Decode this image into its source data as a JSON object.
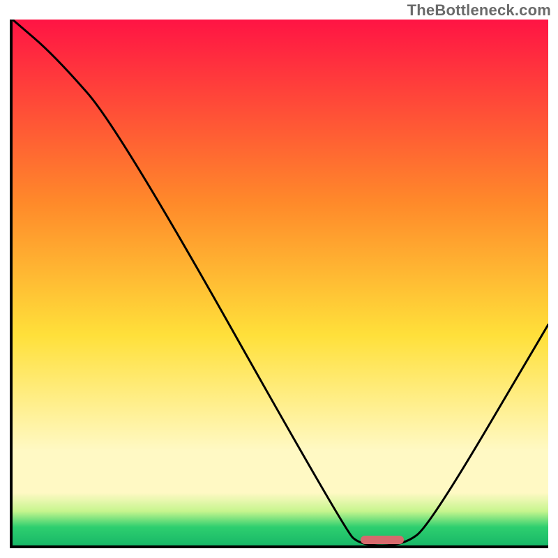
{
  "watermark": "TheBottleneck.com",
  "colors": {
    "top": "#ff1444",
    "mid_top": "#ff8a2a",
    "mid": "#ffe03a",
    "cream": "#fff9c4",
    "band_light": "#c6f58e",
    "band_green": "#2ecf6f",
    "band_dark": "#18b868",
    "curve": "#000000",
    "marker": "#d66a6d",
    "axis": "#000000"
  },
  "chart_data": {
    "type": "line",
    "title": "",
    "xlabel": "",
    "ylabel": "",
    "xlim": [
      0,
      100
    ],
    "ylim": [
      0,
      100
    ],
    "x": [
      0,
      8,
      20,
      62,
      65,
      73,
      78,
      100
    ],
    "values": [
      100,
      93,
      79,
      3,
      0,
      0,
      4,
      42
    ],
    "annotations": [
      {
        "kind": "marker",
        "x_start": 65,
        "x_end": 73,
        "y": 0
      }
    ],
    "gradient_stops": [
      {
        "offset": 0.0,
        "color_key": "top"
      },
      {
        "offset": 0.35,
        "color_key": "mid_top"
      },
      {
        "offset": 0.6,
        "color_key": "mid"
      },
      {
        "offset": 0.82,
        "color_key": "cream"
      },
      {
        "offset": 0.9,
        "color_key": "cream"
      },
      {
        "offset": 0.935,
        "color_key": "band_light"
      },
      {
        "offset": 0.965,
        "color_key": "band_green"
      },
      {
        "offset": 1.0,
        "color_key": "band_dark"
      }
    ]
  }
}
